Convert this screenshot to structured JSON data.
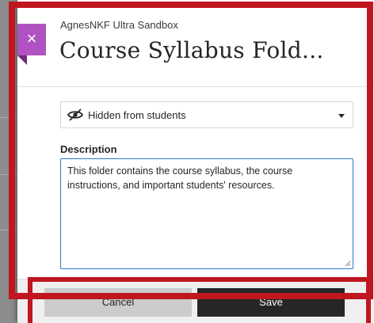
{
  "panel": {
    "course_name": "AgnesNKF Ultra Sandbox",
    "title": "Course Syllabus Fold...",
    "close_icon": "close-icon"
  },
  "visibility": {
    "icon": "eye-slash-icon",
    "selected": "Hidden from students"
  },
  "description": {
    "label": "Description",
    "value": "This folder contains the course syllabus, the course instructions, and important students' resources."
  },
  "footer": {
    "cancel_label": "Cancel",
    "save_label": "Save"
  },
  "colors": {
    "accent_purple": "#b052c2",
    "highlight_red": "#c0161f",
    "focus_blue": "#2b79c8",
    "save_dark": "#262626"
  }
}
